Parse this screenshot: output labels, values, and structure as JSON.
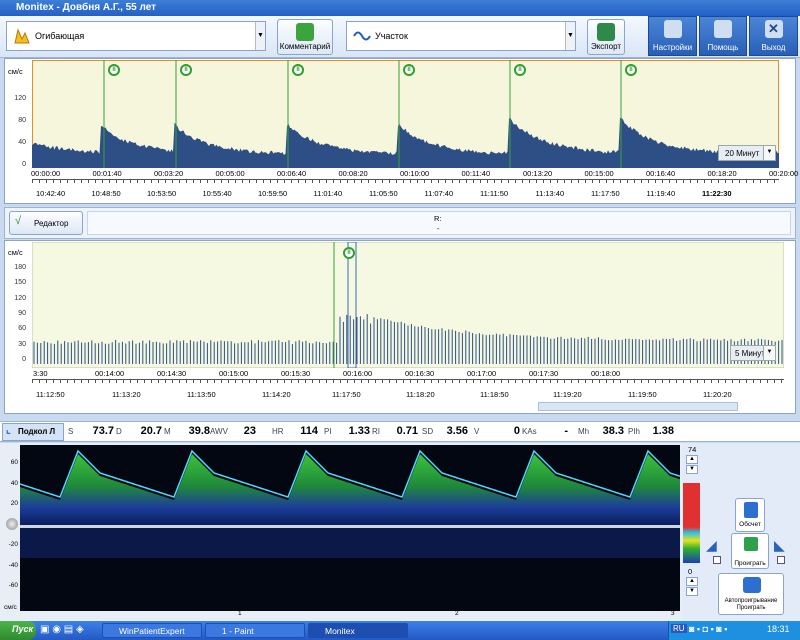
{
  "window": {
    "title": "Monitex - Довбня А.Г., 55 лет"
  },
  "toolbar": {
    "mode_select": "Огибающая",
    "comment_button": "Комментарий",
    "section_select": "Участок",
    "export_button": "Экспорт",
    "settings_button": "Настройки",
    "help_button": "Помощь",
    "exit_button": "Выход"
  },
  "top_chart": {
    "y_unit": "cм/с",
    "y_ticks": [
      "120",
      "80",
      "40",
      "0"
    ],
    "window_select": "20 Минут",
    "time_ticks": [
      "00:00:00",
      "00:01:40",
      "00:03:20",
      "00:05:00",
      "00:06:40",
      "00:08:20",
      "00:10:00",
      "00:11:40",
      "00:13:20",
      "00:15:00",
      "00:16:40",
      "00:18:20",
      "00:20:00"
    ],
    "clock_ticks": [
      "10:42:40",
      "10:48:50",
      "10:53:50",
      "10:55:40",
      "10:59:50",
      "11:01:40",
      "11:05:50",
      "11:07:40",
      "11:11:50",
      "11:13:40",
      "11:17:50",
      "11:19:40",
      "11:22:30"
    ],
    "markers": [
      "II",
      "II",
      "II",
      "II",
      "II",
      "II",
      "II"
    ]
  },
  "editor": {
    "button": "Редактор",
    "r_label": "R:",
    "r_value": "-"
  },
  "mid_chart": {
    "y_unit": "cм/с",
    "y_ticks": [
      "180",
      "150",
      "120",
      "90",
      "60",
      "30",
      "0"
    ],
    "window_select": "5 Минут",
    "time_ticks": [
      "3:30",
      "00:14:00",
      "00:14:30",
      "00:15:00",
      "00:15:30",
      "00:16:00",
      "00:16:30",
      "00:17:00",
      "00:17:30",
      "00:18:00"
    ],
    "clock_ticks": [
      "11:12:50",
      "11:13:20",
      "11:13:50",
      "11:14:20",
      "11:17:50",
      "11:18:20",
      "11:18:50",
      "11:19:20",
      "11:19:50",
      "11:20:20"
    ],
    "marker": "II"
  },
  "measurements": {
    "vessel": "Подкол Л",
    "items": [
      {
        "name": "S",
        "value": "73.7"
      },
      {
        "name": "D",
        "value": "20.7"
      },
      {
        "name": "M",
        "value": "39.8"
      },
      {
        "name": "AWV",
        "value": "23"
      },
      {
        "name": "HR",
        "value": "114"
      },
      {
        "name": "PI",
        "value": "1.33"
      },
      {
        "name": "RI",
        "value": "0.71"
      },
      {
        "name": "SD",
        "value": "3.56"
      },
      {
        "name": "V",
        "value": "0"
      },
      {
        "name": "KAs",
        "value": "-"
      },
      {
        "name": "Mh",
        "value": "38.3"
      },
      {
        "name": "PIh",
        "value": "1.38"
      }
    ]
  },
  "spectrum": {
    "y_ticks": [
      "60",
      "40",
      "20",
      "0",
      "-20",
      "-40",
      "-60"
    ],
    "scale_top": "74",
    "scale_zero": "0",
    "x_ticks": [
      "1",
      "2",
      "3"
    ],
    "gain_unit": "cм/с"
  },
  "side_buttons": {
    "recount": "Обсчет",
    "play": "Проиграть",
    "autoplay": "Автопроигрывание Проиграть"
  },
  "taskbar": {
    "start": "Пуск",
    "tasks": [
      "WinPatientExpert",
      "1 - Paint",
      "Monitex"
    ],
    "lang": "RU",
    "clock": "18:31"
  }
}
